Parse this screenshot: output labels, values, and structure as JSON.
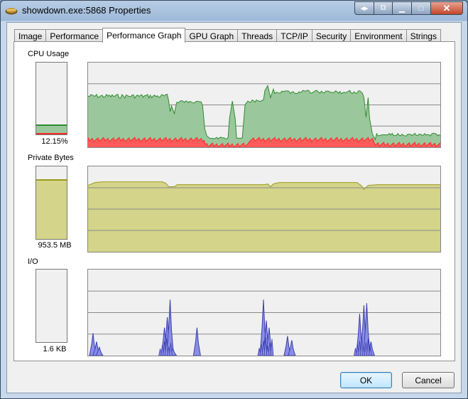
{
  "window": {
    "title": "showdown.exe:5868 Properties"
  },
  "tabs": [
    {
      "label": "Image"
    },
    {
      "label": "Performance"
    },
    {
      "label": "Performance Graph",
      "active": true
    },
    {
      "label": "GPU Graph"
    },
    {
      "label": "Threads"
    },
    {
      "label": "TCP/IP"
    },
    {
      "label": "Security"
    },
    {
      "label": "Environment"
    },
    {
      "label": "Strings"
    }
  ],
  "cpu": {
    "label": "CPU Usage",
    "value": "12.15%",
    "level": 0.1215,
    "fill_color": "#9bc79c",
    "line_color": "#2f8a2f",
    "kernel_color": "#ff2a2a"
  },
  "private_bytes": {
    "label": "Private Bytes",
    "value": "953.5 MB",
    "level": 0.8,
    "fill_color": "#d4d48a",
    "line_color": "#9b9b1a"
  },
  "io": {
    "label": "I/O",
    "value": "1.6  KB",
    "fill_color": "#8a8ee6",
    "line_color": "#3b3fb0"
  },
  "buttons": {
    "ok": "OK",
    "cancel": "Cancel"
  }
}
